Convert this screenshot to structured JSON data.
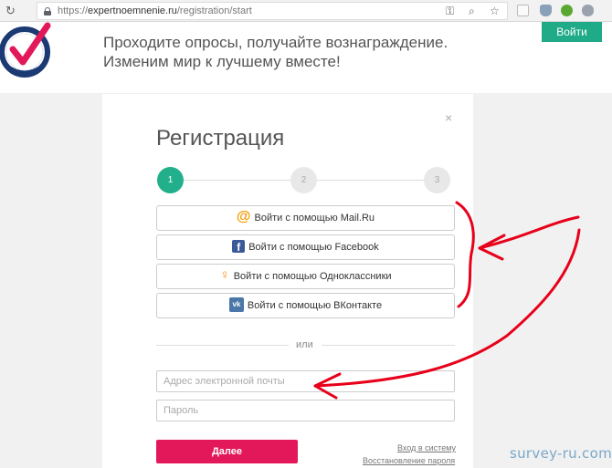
{
  "browser": {
    "url_scheme": "https://",
    "url_host": "expertnoemnenie.ru",
    "url_path": "/registration/start"
  },
  "header": {
    "tagline_line1": "Проходите опросы, получайте вознаграждение.",
    "tagline_line2": "Изменим мир к лучшему вместе!",
    "login_label": "Войти"
  },
  "modal": {
    "close_label": "×",
    "title": "Регистрация",
    "steps": [
      "1",
      "2",
      "3"
    ],
    "social_buttons": [
      {
        "icon": "@",
        "label": "Войти с помощью Mail.Ru"
      },
      {
        "icon": "f",
        "label": "Войти с помощью Facebook"
      },
      {
        "icon": "ok",
        "label": "Войти с помощью Одноклассники"
      },
      {
        "icon": "vk",
        "label": "Войти с помощью ВКонтакте"
      }
    ],
    "divider_label": "или",
    "email_placeholder": "Адрес электронной почты",
    "password_placeholder": "Пароль",
    "submit_label": "Далее",
    "login_link": "Вход в систему",
    "recover_link": "Восстановление пароля"
  },
  "watermark": "survey-ru.com",
  "colors": {
    "accent_green": "#1fab87",
    "submit_red": "#e3185a",
    "annotation_red": "#e8001a"
  }
}
